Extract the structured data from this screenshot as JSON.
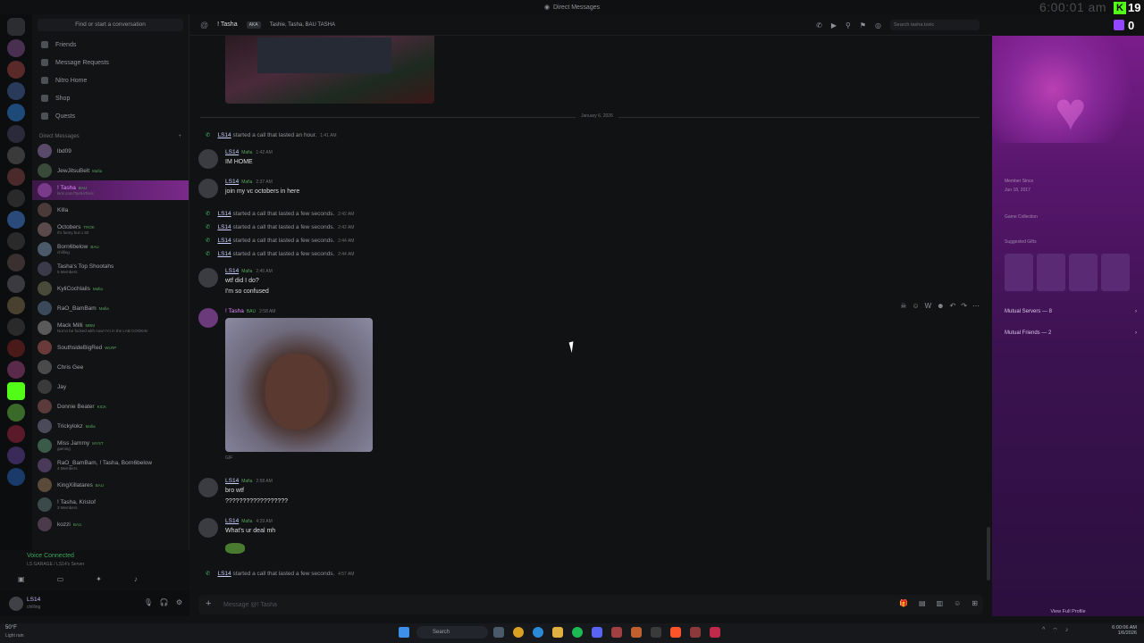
{
  "window": {
    "title": "Direct Messages",
    "clock": "6:00:01 am"
  },
  "overlay": {
    "kick_count": "19",
    "twitch_count": "0"
  },
  "sidebar": {
    "search_placeholder": "Find or start a conversation",
    "nav": [
      {
        "label": "Friends",
        "icon": "friends-icon"
      },
      {
        "label": "Message Requests",
        "icon": "message-requests-icon"
      },
      {
        "label": "Nitro Home",
        "icon": "nitro-icon"
      },
      {
        "label": "Shop",
        "icon": "shop-icon"
      },
      {
        "label": "Quests",
        "icon": "quests-icon"
      }
    ],
    "dm_header": "Direct Messages",
    "dms": [
      {
        "name": "lbd09",
        "badge": "",
        "sub": ""
      },
      {
        "name": "JewJitsuBelt",
        "badge": "Mafia",
        "sub": ""
      },
      {
        "name": "! Tasha",
        "badge": "BAU",
        "sub": "kick.com/TashaToxic"
      },
      {
        "name": "Killa",
        "badge": "",
        "sub": ""
      },
      {
        "name": "Octobers",
        "badge": "TROK",
        "sub": "it's funny but u 30"
      },
      {
        "name": "Born6below",
        "badge": "BAU",
        "sub": "chilling"
      },
      {
        "name": "Tasha's Top Shootahs",
        "badge": "",
        "sub": "5 Members"
      },
      {
        "name": "KyliCochlails",
        "badge": "Mafia",
        "sub": ""
      },
      {
        "name": "RaO_BamBam",
        "badge": "Mafia",
        "sub": ""
      },
      {
        "name": "Mack Milli",
        "badge": "MBM",
        "sub": "Not to be fucked with now! I'm in the LAB COOKIN"
      },
      {
        "name": "SouthsideBigRed",
        "badge": "WLRP",
        "sub": ""
      },
      {
        "name": "Chris Gee",
        "badge": "",
        "sub": ""
      },
      {
        "name": "Jay",
        "badge": "",
        "sub": ""
      },
      {
        "name": "Donnie Beater",
        "badge": "KICK",
        "sub": ""
      },
      {
        "name": "Trickylokz",
        "badge": "Mafia",
        "sub": ""
      },
      {
        "name": "Miss Jammy",
        "badge": "MYST",
        "sub": "gaming"
      },
      {
        "name": "RaO_BamBam, ! Tasha, Born6below",
        "badge": "",
        "sub": "4 Members"
      },
      {
        "name": "KingXillatares",
        "badge": "BAU",
        "sub": ""
      },
      {
        "name": "! Tasha, Kristof",
        "badge": "",
        "sub": "3 Members"
      },
      {
        "name": "kozzi",
        "badge": "BAU",
        "sub": ""
      }
    ],
    "voice": {
      "status": "Voice Connected",
      "server": "LS GARAGE / LS14's Server"
    },
    "user": {
      "name": "LS14",
      "status": "chilling"
    }
  },
  "chat": {
    "header_name": "! Tasha",
    "aka_label": "AKA",
    "aliases": "Tashie, Tasha, BAU TASHA",
    "search_placeholder": "Search tasha.toxic",
    "date_divider": "January 6, 2026",
    "composer_placeholder": "Message @! Tasha",
    "gif_label": "GIF",
    "messages": [
      {
        "kind": "system",
        "user": "LS14",
        "text": "started a call that lasted an hour.",
        "time": "1:41 AM"
      },
      {
        "kind": "msg",
        "user": "LS14",
        "tag": "Mafia",
        "time": "1:42 AM",
        "lines": [
          "IM HOME"
        ]
      },
      {
        "kind": "msg",
        "user": "LS14",
        "tag": "Mafia",
        "time": "2:37 AM",
        "lines": [
          "join my vc octobers in here"
        ]
      },
      {
        "kind": "system",
        "user": "LS14",
        "text": "started a call that lasted a few seconds.",
        "time": "2:42 AM"
      },
      {
        "kind": "system",
        "user": "LS14",
        "text": "started a call that lasted a few seconds.",
        "time": "2:42 AM"
      },
      {
        "kind": "system",
        "user": "LS14",
        "text": "started a call that lasted a few seconds.",
        "time": "2:44 AM"
      },
      {
        "kind": "system",
        "user": "LS14",
        "text": "started a call that lasted a few seconds.",
        "time": "2:44 AM"
      },
      {
        "kind": "msg",
        "user": "LS14",
        "tag": "Mafia",
        "time": "2:45 AM",
        "lines": [
          "wtf did I do?",
          "I'm so confused"
        ]
      },
      {
        "kind": "msg",
        "user": "! Tasha",
        "tag": "BAU",
        "time": "2:58 AM",
        "lines": []
      },
      {
        "kind": "msg",
        "user": "LS14",
        "tag": "Mafia",
        "time": "2:58 AM",
        "lines": [
          "bro wtf",
          "??????????????????"
        ]
      },
      {
        "kind": "msg",
        "user": "LS14",
        "tag": "Mafia",
        "time": "4:29 AM",
        "lines": [
          "What's ur deal mh"
        ]
      },
      {
        "kind": "system",
        "user": "LS14",
        "text": "started a call that lasted a few seconds.",
        "time": "4:57 AM"
      }
    ]
  },
  "profile": {
    "member_since_label": "Member Since",
    "member_since": "Jun 18, 2017",
    "game_collection": "Game Collection",
    "suggested_gifts": "Suggested Gifts",
    "mutual_servers": "Mutual Servers — 8",
    "mutual_friends": "Mutual Friends — 2",
    "view_full_profile": "View Full Profile"
  },
  "taskbar": {
    "weather_temp": "50°F",
    "weather_desc": "Light rain",
    "search": "Search",
    "time": "6:00:06 AM",
    "date": "1/6/2026"
  }
}
